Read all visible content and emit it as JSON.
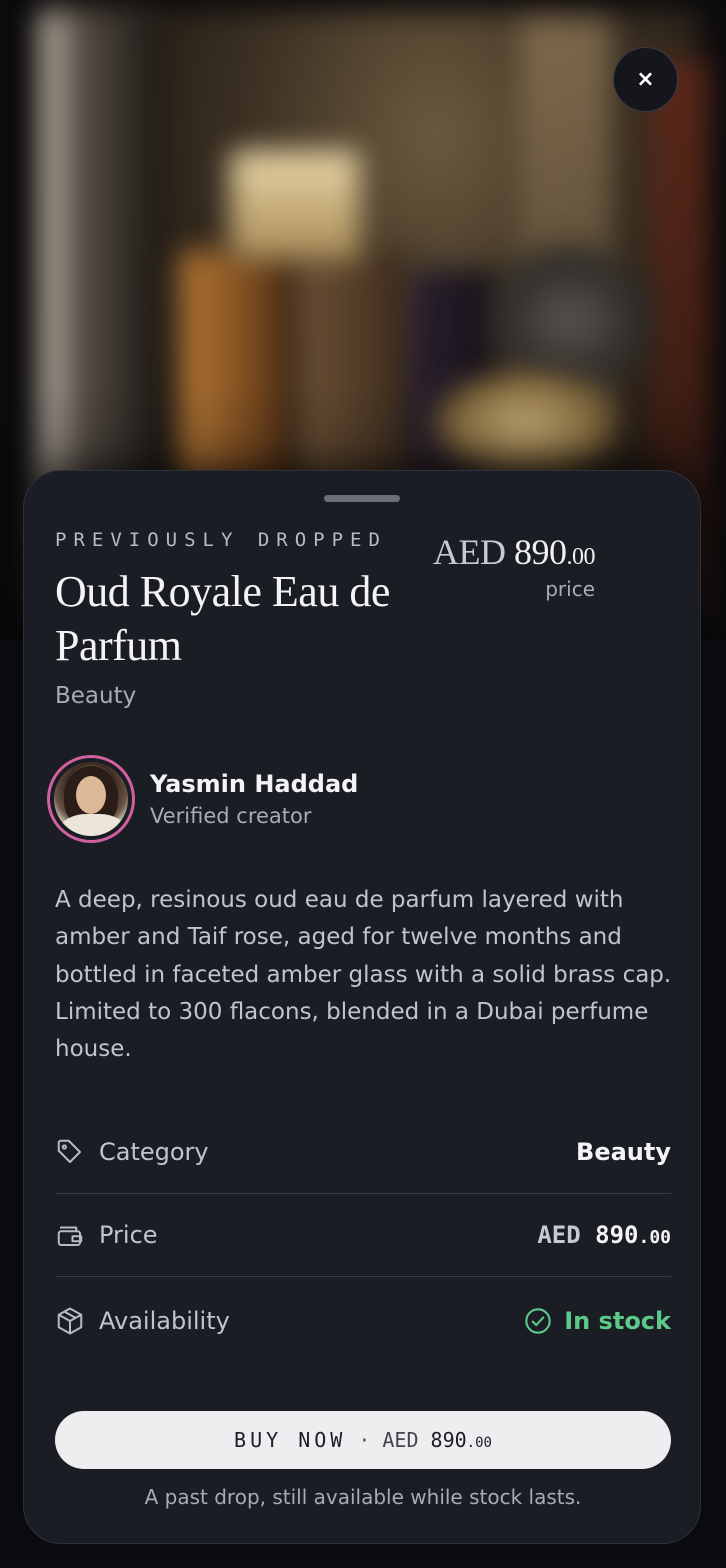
{
  "close": {
    "glyph": "×"
  },
  "product": {
    "eyebrow": "PREVIOUSLY DROPPED",
    "title": "Oud Royale Eau de Parfum",
    "category": "Beauty",
    "price": {
      "currency": "AED",
      "whole": "890",
      "cents": ".00",
      "label": "price"
    },
    "description": "A deep, resinous oud eau de parfum layered with amber and Taif rose, aged for twelve months and bottled in faceted amber glass with a solid brass cap. Limited to 300 flacons, blended in a Dubai perfume house."
  },
  "creator": {
    "name": "Yasmin Haddad",
    "role": "Verified creator"
  },
  "details": [
    {
      "icon": "tag-icon",
      "label": "Category",
      "value": "Beauty"
    },
    {
      "icon": "wallet-icon",
      "label": "Price",
      "currency": "AED",
      "whole": "890",
      "cents": ".00"
    },
    {
      "icon": "box-icon",
      "label": "Availability",
      "value": "In stock",
      "status_color": "#5cc98a"
    }
  ],
  "cta": {
    "label": "BUY NOW",
    "separator": "·",
    "currency": "AED",
    "whole": "890",
    "cents": ".00"
  },
  "footnote": "A past drop, still available while stock lasts.",
  "colors": {
    "sheet": "#1b1d24",
    "accent_ring": "#d0609e",
    "in_stock": "#5cc98a",
    "button": "#eeeef1"
  }
}
